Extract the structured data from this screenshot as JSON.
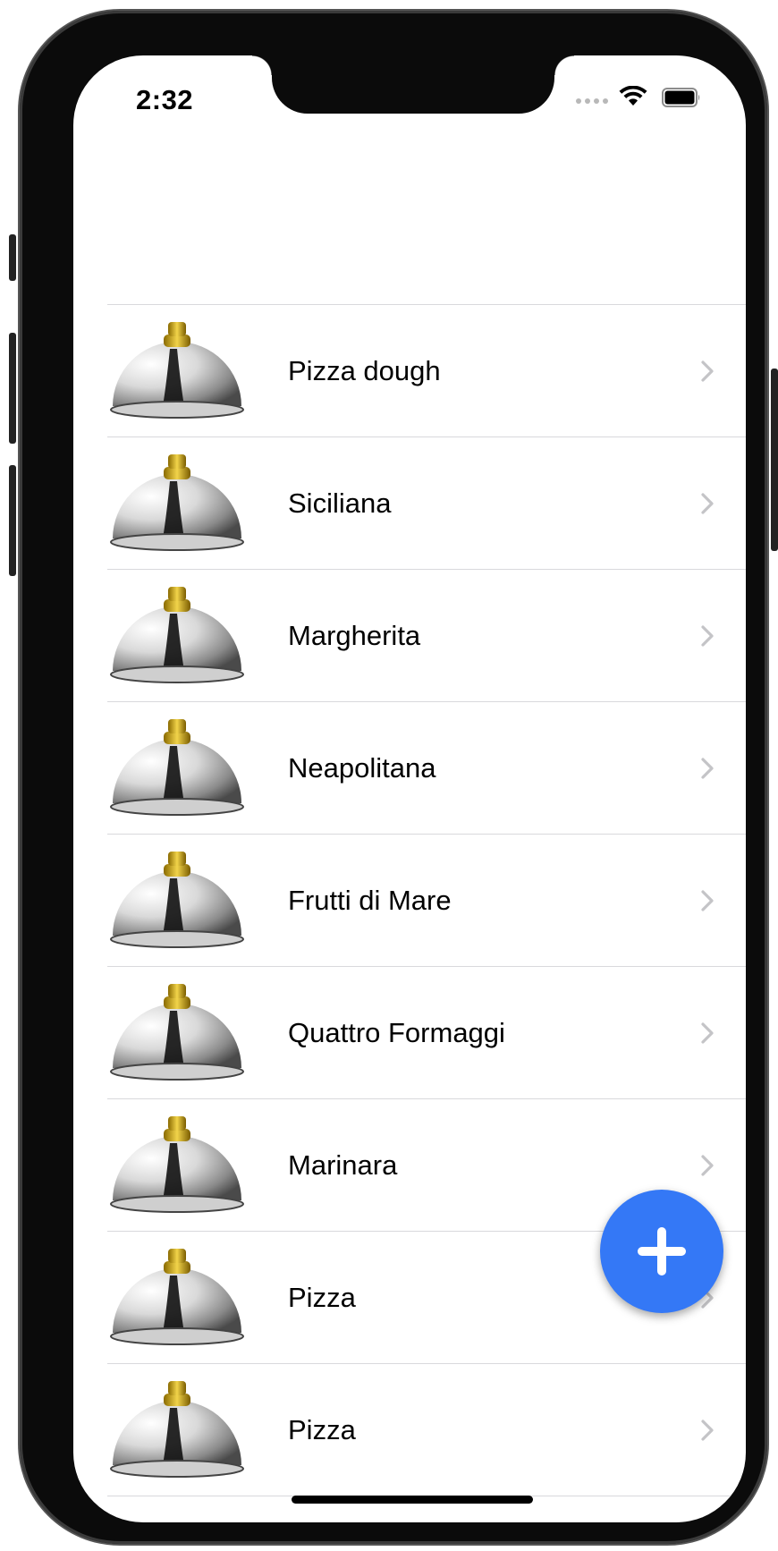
{
  "status_bar": {
    "time": "2:32",
    "wifi_icon": "wifi-icon",
    "battery_icon": "battery-icon"
  },
  "recipes": {
    "items": [
      {
        "name": "Pizza dough",
        "image_icon": "cloche-icon"
      },
      {
        "name": "Siciliana",
        "image_icon": "cloche-icon"
      },
      {
        "name": "Margherita",
        "image_icon": "cloche-icon"
      },
      {
        "name": "Neapolitana",
        "image_icon": "cloche-icon"
      },
      {
        "name": "Frutti di Mare",
        "image_icon": "cloche-icon"
      },
      {
        "name": "Quattro Formaggi",
        "image_icon": "cloche-icon"
      },
      {
        "name": "Marinara",
        "image_icon": "cloche-icon"
      },
      {
        "name": "Pizza",
        "image_icon": "cloche-icon"
      },
      {
        "name": "Pizza",
        "image_icon": "cloche-icon"
      }
    ]
  },
  "add_button": {
    "icon": "plus-icon",
    "color": "#3478f6"
  }
}
